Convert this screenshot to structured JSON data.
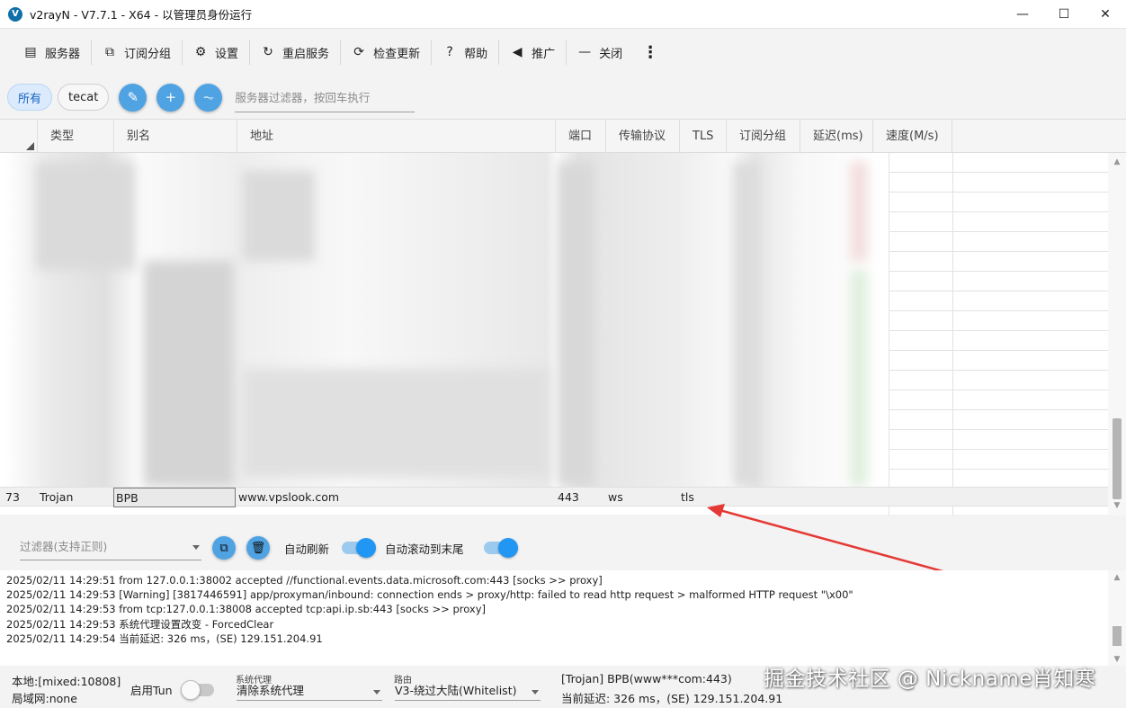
{
  "window": {
    "title": "v2rayN - V7.7.1 - X64 - 以管理员身份运行",
    "app_icon": "V",
    "controls": {
      "minimize": "—",
      "maximize": "☐",
      "close": "✕"
    }
  },
  "toolbar": {
    "items": [
      {
        "icon": "server-icon",
        "glyph": "▤",
        "label": "服务器"
      },
      {
        "icon": "subscription-icon",
        "glyph": "⧉",
        "label": "订阅分组"
      },
      {
        "icon": "gear-icon",
        "glyph": "⚙",
        "label": "设置"
      },
      {
        "icon": "restart-icon",
        "glyph": "↻",
        "label": "重启服务"
      },
      {
        "icon": "update-icon",
        "glyph": "⟳",
        "label": "检查更新"
      },
      {
        "icon": "help-icon",
        "glyph": "?",
        "label": "帮助"
      },
      {
        "icon": "speaker-icon",
        "glyph": "◀",
        "label": "推广"
      },
      {
        "icon": "minus-icon",
        "glyph": "—",
        "label": "关闭"
      }
    ],
    "more": "⋮"
  },
  "filters": {
    "chips": [
      "所有",
      "tecat"
    ],
    "server_filter_placeholder": "服务器过滤器，按回车执行",
    "btn_edit": "✎",
    "btn_add": "+",
    "btn_speed": "⏦"
  },
  "grid": {
    "columns": [
      "类型",
      "别名",
      "地址",
      "端口",
      "传输协议",
      "TLS",
      "订阅分组",
      "延迟(ms)",
      "速度(M/s)"
    ],
    "selected_row": {
      "index": "73",
      "type": "Trojan",
      "alias": "BPB",
      "address": "www.vpslook.com",
      "port": "443",
      "network": "ws",
      "tls": "tls"
    }
  },
  "log_toolbar": {
    "filter_placeholder": "过滤器(支持正则)",
    "copy_icon": "⧉",
    "delete_icon": "🗑",
    "auto_refresh_label": "自动刷新",
    "auto_refresh": true,
    "auto_scroll_label": "自动滚动到末尾",
    "auto_scroll": true
  },
  "log": {
    "lines": [
      "2025/02/11 14:29:51 from 127.0.0.1:38002 accepted //functional.events.data.microsoft.com:443 [socks >> proxy]",
      "2025/02/11 14:29:53 [Warning] [3817446591] app/proxyman/inbound: connection ends > proxy/http: failed to read http request > malformed HTTP request \"\\x00\"",
      "2025/02/11 14:29:53 from tcp:127.0.0.1:38008 accepted tcp:api.ip.sb:443 [socks >> proxy]",
      "2025/02/11 14:29:53 系统代理设置改变 - ForcedClear",
      "2025/02/11 14:29:54 当前延迟: 326 ms，(SE) 129.151.204.91"
    ]
  },
  "status": {
    "local": "本地:[mixed:10808]",
    "lan": "局域网:none",
    "tun_label": "启用Tun",
    "tun_enabled": false,
    "sysproxy_caption": "系统代理",
    "sysproxy_value": "清除系统代理",
    "routing_caption": "路由",
    "routing_value": "V3-绕过大陆(Whitelist)",
    "current_server": "[Trojan] BPB(www***com:443)",
    "current_delay": "当前延迟: 326 ms，(SE) 129.151.204.91"
  },
  "watermark": "掘金技术社区 @ Nickname肖知寒",
  "colors": {
    "accent": "#2196f3",
    "button": "#4fa3e3",
    "arrow": "#e53935"
  }
}
